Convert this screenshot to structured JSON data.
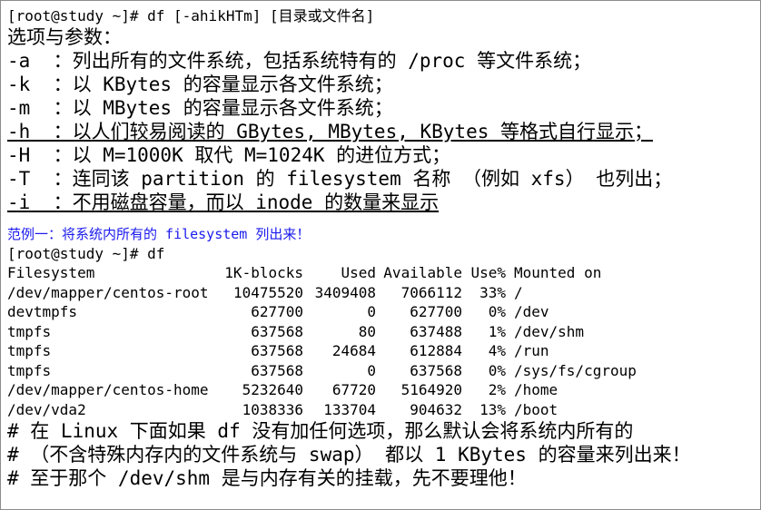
{
  "syntax_line": "[root@study ~]# df [-ahikHTm] [目录或文件名]",
  "options_heading": "选项与参数：",
  "options": [
    {
      "text": "-a  ：列出所有的文件系统，包括系统特有的 /proc 等文件系统；",
      "underlined": false
    },
    {
      "text": "-k  ：以 KBytes 的容量显示各文件系统；",
      "underlined": false
    },
    {
      "text": "-m  ：以 MBytes 的容量显示各文件系统；",
      "underlined": false
    },
    {
      "text": "-h  ：以人们较易阅读的 GBytes, MBytes, KBytes 等格式自行显示；",
      "underlined": true
    },
    {
      "text": "-H  ：以 M=1000K 取代 M=1024K 的进位方式；",
      "underlined": false
    },
    {
      "text": "-T  ：连同该 partition 的 filesystem 名称 （例如 xfs） 也列出；",
      "underlined": false
    },
    {
      "text": "-i  ：不用磁盘容量，而以 inode 的数量来显示",
      "underlined": true
    }
  ],
  "example_title": "范例一：将系统内所有的 filesystem 列出来！",
  "example_command": "[root@study ~]# df",
  "table": {
    "headers": {
      "filesystem": "Filesystem",
      "blocks": "1K-blocks",
      "used": "Used",
      "available": "Available",
      "use_pct": "Use%",
      "mounted": "Mounted on"
    },
    "rows": [
      {
        "filesystem": "/dev/mapper/centos-root",
        "blocks": "10475520",
        "used": "3409408",
        "available": "7066112",
        "use_pct": "33%",
        "mounted": "/"
      },
      {
        "filesystem": "devtmpfs",
        "blocks": "627700",
        "used": "0",
        "available": "627700",
        "use_pct": "0%",
        "mounted": "/dev"
      },
      {
        "filesystem": "tmpfs",
        "blocks": "637568",
        "used": "80",
        "available": "637488",
        "use_pct": "1%",
        "mounted": "/dev/shm"
      },
      {
        "filesystem": "tmpfs",
        "blocks": "637568",
        "used": "24684",
        "available": "612884",
        "use_pct": "4%",
        "mounted": "/run"
      },
      {
        "filesystem": "tmpfs",
        "blocks": "637568",
        "used": "0",
        "available": "637568",
        "use_pct": "0%",
        "mounted": "/sys/fs/cgroup"
      },
      {
        "filesystem": "/dev/mapper/centos-home",
        "blocks": "5232640",
        "used": "67720",
        "available": "5164920",
        "use_pct": "2%",
        "mounted": "/home"
      },
      {
        "filesystem": "/dev/vda2",
        "blocks": "1038336",
        "used": "133704",
        "available": "904632",
        "use_pct": "13%",
        "mounted": "/boot"
      }
    ]
  },
  "comments": [
    "# 在 Linux 下面如果 df 没有加任何选项，那么默认会将系统内所有的",
    "# （不含特殊内存内的文件系统与 swap） 都以 1 KBytes 的容量来列出来！",
    "# 至于那个 /dev/shm 是与内存有关的挂载，先不要理他！"
  ],
  "colors": {
    "text": "#000000",
    "example_title": "#1a1aee",
    "border": "#8c8c8c"
  }
}
